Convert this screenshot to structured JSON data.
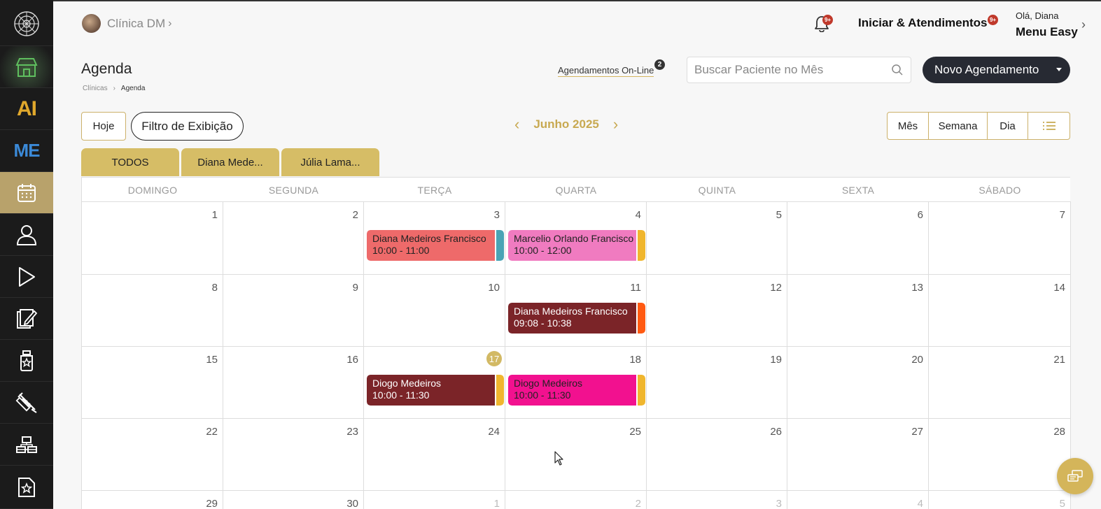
{
  "header": {
    "clinic_name": "Clínica DM",
    "notifications_badge": "9+",
    "start_label": "Iniciar & Atendimentos",
    "start_badge": "9+",
    "greeting": "Olá, Diana",
    "menu_label": "Menu Easy"
  },
  "sidebar": {
    "items": [
      {
        "name": "logo",
        "icon": "mandala-logo-icon"
      },
      {
        "name": "store",
        "icon": "store-icon"
      },
      {
        "name": "ai",
        "label": "AI"
      },
      {
        "name": "me",
        "label": "ME"
      },
      {
        "name": "calendar",
        "icon": "calendar-icon",
        "active": true
      },
      {
        "name": "patients",
        "icon": "user-icon"
      },
      {
        "name": "play",
        "icon": "play-icon"
      },
      {
        "name": "records",
        "icon": "notes-edit-icon"
      },
      {
        "name": "products",
        "icon": "bottle-star-icon"
      },
      {
        "name": "procedures",
        "icon": "syringe-icon"
      },
      {
        "name": "structure",
        "icon": "org-chart-icon"
      },
      {
        "name": "favorites",
        "icon": "doc-star-icon"
      }
    ]
  },
  "page": {
    "title": "Agenda",
    "breadcrumb": [
      "Clínicas",
      "Agenda"
    ],
    "online_label": "Agendamentos On-Line",
    "online_count": "2",
    "search_placeholder": "Buscar Paciente no Mês",
    "new_button": "Novo Agendamento"
  },
  "toolbar": {
    "today": "Hoje",
    "filter": "Filtro de Exibição",
    "month": "Junho 2025",
    "views": [
      "Mês",
      "Semana",
      "Dia"
    ]
  },
  "tabs": [
    "TODOS",
    "Diana Mede...",
    "Júlia Lama..."
  ],
  "calendar": {
    "weekdays": [
      "DOMINGO",
      "SEGUNDA",
      "TERÇA",
      "QUARTA",
      "QUINTA",
      "SEXTA",
      "SÁBADO"
    ],
    "weeks": [
      [
        "1",
        "2",
        "3",
        "4",
        "5",
        "6",
        "7"
      ],
      [
        "8",
        "9",
        "10",
        "11",
        "12",
        "13",
        "14"
      ],
      [
        "15",
        "16",
        "17",
        "18",
        "19",
        "20",
        "21"
      ],
      [
        "22",
        "23",
        "24",
        "25",
        "26",
        "27",
        "28"
      ],
      [
        "29",
        "30",
        "1",
        "2",
        "3",
        "4",
        "5"
      ]
    ],
    "today": "17",
    "events": [
      {
        "week": 0,
        "day": 2,
        "name": "Diana Medeiros Francisco",
        "time": "10:00 - 11:00",
        "color": "#ee6a6a",
        "text": "#222222",
        "strip": "#4aa3b5"
      },
      {
        "week": 0,
        "day": 3,
        "name": "Marcelio Orlando Francisco",
        "time": "10:00 - 12:00",
        "color": "#f07bc0",
        "text": "#222222",
        "strip": "#f0b62e"
      },
      {
        "week": 1,
        "day": 3,
        "name": "Diana Medeiros Francisco",
        "time": "09:08 - 10:38",
        "color": "#7b2428",
        "text": "#ffffff",
        "strip": "#ff5a12"
      },
      {
        "week": 2,
        "day": 2,
        "name": "Diogo Medeiros",
        "time": "10:00 - 11:30",
        "color": "#7b2428",
        "text": "#ffffff",
        "strip": "#f0b62e"
      },
      {
        "week": 2,
        "day": 3,
        "name": "Diogo Medeiros",
        "time": "10:00 - 11:30",
        "color": "#f2118f",
        "text": "#222222",
        "strip": "#f0b62e"
      }
    ]
  },
  "colors": {
    "accent": "#d6bd66",
    "sidebar_bg": "#1b1b1b",
    "dark_button": "#272a33"
  }
}
